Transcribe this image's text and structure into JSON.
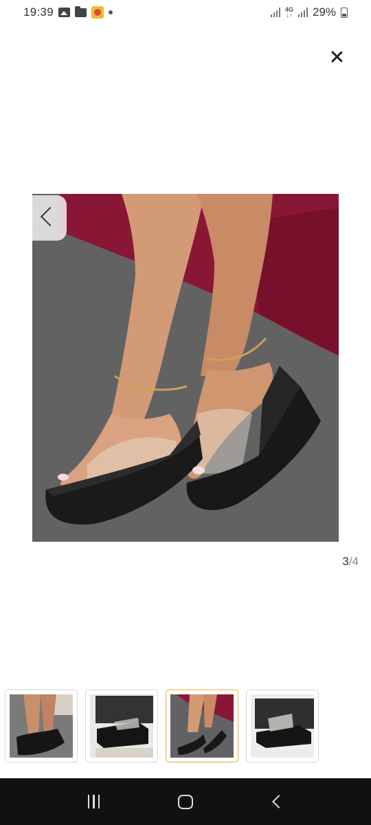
{
  "status_bar": {
    "time": "19:39",
    "battery": "29%",
    "network": "4G",
    "icons": [
      "gallery-icon",
      "folder-icon",
      "app-notification-icon",
      "dot-icon",
      "signal-icon",
      "4g-icon",
      "signal-icon",
      "battery-icon"
    ]
  },
  "viewer": {
    "current": "3",
    "total": "/4",
    "selected_index": 3
  },
  "thumbnails": [
    {
      "name": "thumbnail-1"
    },
    {
      "name": "thumbnail-2"
    },
    {
      "name": "thumbnail-3"
    },
    {
      "name": "thumbnail-4"
    }
  ],
  "colors": {
    "active_thumb_border": "#f0a93a",
    "nav_bar": "#111111"
  }
}
